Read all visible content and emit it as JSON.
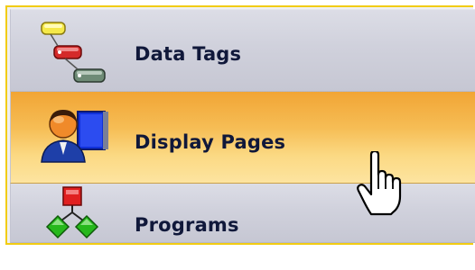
{
  "nav": {
    "items": [
      {
        "label": "Data Tags",
        "icon": "data-tags-icon",
        "active": false
      },
      {
        "label": "Display Pages",
        "icon": "display-pages-icon",
        "active": true
      },
      {
        "label": "Programs",
        "icon": "programs-icon",
        "active": false
      }
    ]
  },
  "colors": {
    "frame_border": "#f2cc12",
    "active_gradient_top": "#f1a535",
    "active_gradient_bottom": "#fde4a0",
    "item_gradient_top": "#dcdde6",
    "item_gradient_bottom": "#c6c7d3",
    "label_text": "#10183a"
  },
  "cursor": {
    "icon": "hand-pointer-cursor"
  }
}
